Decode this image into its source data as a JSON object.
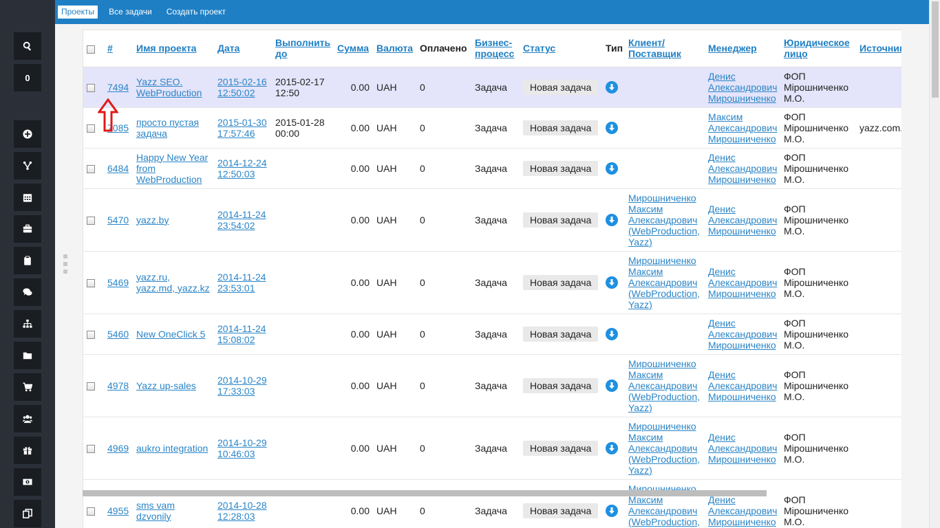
{
  "sidebar": {
    "buttons": [
      {
        "name": "search-icon",
        "label": ""
      },
      {
        "name": "notification-count",
        "label": "0"
      },
      {
        "name": "plus-circle-icon",
        "label": ""
      },
      {
        "name": "fork-icon",
        "label": ""
      },
      {
        "name": "calendar-icon",
        "label": ""
      },
      {
        "name": "briefcase-icon",
        "label": ""
      },
      {
        "name": "clipboard-icon",
        "label": ""
      },
      {
        "name": "comments-icon",
        "label": ""
      },
      {
        "name": "sitemap-icon",
        "label": ""
      },
      {
        "name": "folder-icon",
        "label": ""
      },
      {
        "name": "cart-icon",
        "label": ""
      },
      {
        "name": "users-icon",
        "label": ""
      },
      {
        "name": "gift-icon",
        "label": ""
      },
      {
        "name": "money-icon",
        "label": ""
      },
      {
        "name": "copy-icon",
        "label": ""
      }
    ]
  },
  "topnav": {
    "projects": "Проекты",
    "all_tasks": "Все задачи",
    "create_project": "Создать проект"
  },
  "table": {
    "headers": {
      "id": "#",
      "name": "Имя проекта",
      "date": "Дата",
      "due": "Выполнить до",
      "sum": "Сумма",
      "currency": "Валюта",
      "paid": "Оплачено",
      "process": "Бизнес-процесс",
      "status": "Статус",
      "type": "Тип",
      "client": "Клиент/ Поставщик",
      "manager": "Менеджер",
      "legal": "Юридическое лицо",
      "source": "Источник"
    },
    "rows": [
      {
        "id": "7494",
        "name": "Yazz SEO. WebProduction",
        "date": "2015-02-16 12:50:02",
        "due": "2015-02-17 12:50",
        "sum": "0.00",
        "currency": "UAH",
        "paid": "0",
        "process": "Задача",
        "status": "Новая задача",
        "client": "",
        "manager": "Денис Александрович Мирошниченко",
        "legal": "ФОП Мірошниченко М.О.",
        "source": ""
      },
      {
        "id": "7085",
        "name": "просто пустая задача",
        "date": "2015-01-30 17:57:46",
        "due": "2015-01-28 00:00",
        "sum": "0.00",
        "currency": "UAH",
        "paid": "0",
        "process": "Задача",
        "status": "Новая задача",
        "client": "",
        "manager": "Максим Александрович Мирошниченко",
        "legal": "ФОП Мірошниченко М.О.",
        "source": "yazz.com."
      },
      {
        "id": "6484",
        "name": "Happy New Year from WebProduction",
        "date": "2014-12-24 12:50:03",
        "due": "",
        "sum": "0.00",
        "currency": "UAH",
        "paid": "0",
        "process": "Задача",
        "status": "Новая задача",
        "client": "",
        "manager": "Денис Александрович Мирошниченко",
        "legal": "ФОП Мірошниченко М.О.",
        "source": ""
      },
      {
        "id": "5470",
        "name": "yazz.by",
        "date": "2014-11-24 23:54:02",
        "due": "",
        "sum": "0.00",
        "currency": "UAH",
        "paid": "0",
        "process": "Задача",
        "status": "Новая задача",
        "client": "Мирошниченко Максим Александрович (WebProduction, Yazz)",
        "manager": "Денис Александрович Мирошниченко",
        "legal": "ФОП Мірошниченко М.О.",
        "source": ""
      },
      {
        "id": "5469",
        "name": "yazz.ru, yazz.md, yazz.kz",
        "date": "2014-11-24 23:53:01",
        "due": "",
        "sum": "0.00",
        "currency": "UAH",
        "paid": "0",
        "process": "Задача",
        "status": "Новая задача",
        "client": "Мирошниченко Максим Александрович (WebProduction, Yazz)",
        "manager": "Денис Александрович Мирошниченко",
        "legal": "ФОП Мірошниченко М.О.",
        "source": ""
      },
      {
        "id": "5460",
        "name": "New OneClick 5",
        "date": "2014-11-24 15:08:02",
        "due": "",
        "sum": "0.00",
        "currency": "UAH",
        "paid": "0",
        "process": "Задача",
        "status": "Новая задача",
        "client": "",
        "manager": "Денис Александрович Мирошниченко",
        "legal": "ФОП Мірошниченко М.О.",
        "source": ""
      },
      {
        "id": "4978",
        "name": "Yazz up-sales",
        "date": "2014-10-29 17:33:03",
        "due": "",
        "sum": "0.00",
        "currency": "UAH",
        "paid": "0",
        "process": "Задача",
        "status": "Новая задача",
        "client": "Мирошниченко Максим Александрович (WebProduction, Yazz)",
        "manager": "Денис Александрович Мирошниченко",
        "legal": "ФОП Мірошниченко М.О.",
        "source": ""
      },
      {
        "id": "4969",
        "name": "aukro integration",
        "date": "2014-10-29 10:46:03",
        "due": "",
        "sum": "0.00",
        "currency": "UAH",
        "paid": "0",
        "process": "Задача",
        "status": "Новая задача",
        "client": "Мирошниченко Максим Александрович (WebProduction, Yazz)",
        "manager": "Денис Александрович Мирошниченко",
        "legal": "ФОП Мірошниченко М.О.",
        "source": ""
      },
      {
        "id": "4955",
        "name": "sms vam dzvonily",
        "date": "2014-10-28 12:28:03",
        "due": "",
        "sum": "0.00",
        "currency": "UAH",
        "paid": "0",
        "process": "Задача",
        "status": "Новая задача",
        "client": "Мирошниченко Максим Александрович (WebProduction, Yazz)",
        "manager": "Денис Александрович Мирошниченко",
        "legal": "ФОП Мірошниченко М.О.",
        "source": ""
      }
    ]
  }
}
